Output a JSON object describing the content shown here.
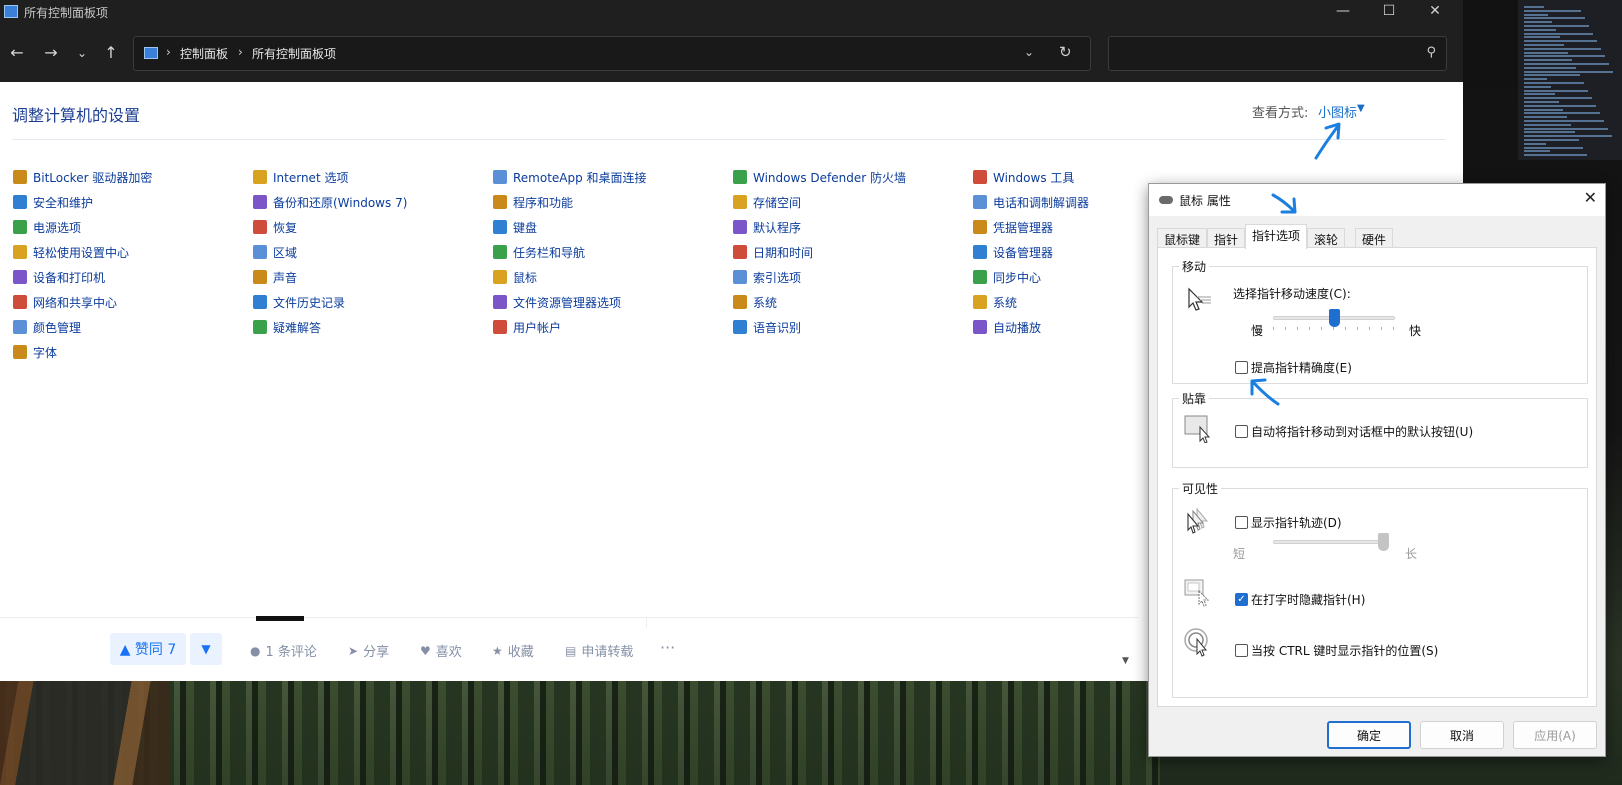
{
  "window": {
    "title": "所有控制面板项",
    "minimize_icon": "minimize-icon",
    "maximize_icon": "maximize-icon",
    "close_icon": "close-icon"
  },
  "addressbar": {
    "breadcrumbs": [
      "控制面板",
      "所有控制面板项"
    ],
    "search_placeholder": ""
  },
  "content": {
    "page_title": "调整计算机的设置",
    "view_label": "查看方式:",
    "view_value": "小图标"
  },
  "columns": [
    [
      "BitLocker 驱动器加密",
      "安全和维护",
      "电源选项",
      "轻松使用设置中心",
      "设备和打印机",
      "网络和共享中心",
      "颜色管理",
      "字体"
    ],
    [
      "Internet 选项",
      "备份和还原(Windows 7)",
      "恢复",
      "区域",
      "声音",
      "文件历史记录",
      "疑难解答"
    ],
    [
      "RemoteApp 和桌面连接",
      "程序和功能",
      "键盘",
      "任务栏和导航",
      "鼠标",
      "文件资源管理器选项",
      "用户帐户"
    ],
    [
      "Windows Defender 防火墙",
      "存储空间",
      "默认程序",
      "日期和时间",
      "索引选项",
      "系统",
      "语音识别"
    ],
    [
      "Windows 工具",
      "电话和调制解调器",
      "凭据管理器",
      "设备管理器",
      "同步中心",
      "系统",
      "自动播放"
    ]
  ],
  "icon_colors": [
    "#c98a1a",
    "#2f7fd3",
    "#3aa14a",
    "#d9a321",
    "#7a56c8",
    "#cf4b3a",
    "#5b8fd6"
  ],
  "comment_bar": {
    "upvote_label": "▲ 赞同 7",
    "downvote_label": "▼",
    "comment_label": "1 条评论",
    "share_label": "分享",
    "like_label": "喜欢",
    "favorite_label": "收藏",
    "reprint_label": "申请转载",
    "more_label": "···"
  },
  "dialog": {
    "title": "鼠标 属性",
    "tabs": [
      "鼠标键",
      "指针",
      "指针选项",
      "滚轮",
      "硬件"
    ],
    "active_tab": "指针选项",
    "motion": {
      "group_label": "移动",
      "speed_label": "选择指针移动速度(C):",
      "slow_label": "慢",
      "fast_label": "快",
      "speed_level": 0.5,
      "precision_label": "提高指针精确度(E)",
      "precision_checked": false
    },
    "snap": {
      "group_label": "贴靠",
      "snap_label": "自动将指针移动到对话框中的默认按钮(U)",
      "snap_checked": false
    },
    "visibility": {
      "group_label": "可见性",
      "trails_label": "显示指针轨迹(D)",
      "trails_checked": false,
      "short_label": "短",
      "long_label": "长",
      "trails_level": 1.0,
      "hide_label": "在打字时隐藏指针(H)",
      "hide_checked": true,
      "ctrl_label": "当按 CTRL 键时显示指针的位置(S)",
      "ctrl_checked": false
    },
    "buttons": {
      "ok": "确定",
      "cancel": "取消",
      "apply": "应用(A)"
    }
  },
  "accent_color": "#1f6fd1",
  "annotation_color": "#1a7fe0"
}
